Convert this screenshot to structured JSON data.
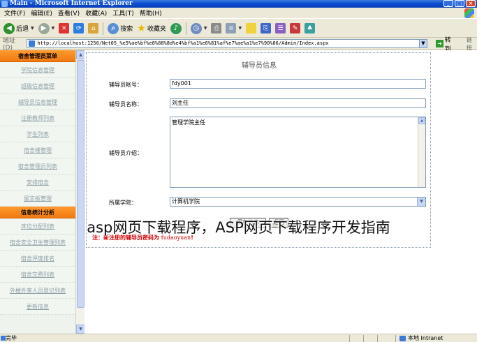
{
  "window": {
    "title": "Main - Microsoft Internet Explorer"
  },
  "menubar": {
    "items": [
      "文件(F)",
      "编辑(E)",
      "查看(V)",
      "收藏(A)",
      "工具(T)",
      "帮助(H)"
    ]
  },
  "toolbar": {
    "back_label": "后退",
    "search_label": "搜索",
    "favorites_label": "收藏夹"
  },
  "addressbar": {
    "label": "地址(D)",
    "url": "http://localhost:1250/Net05_%e5%ae%bf%e8%88%8d%e4%bf%a1%e6%81%af%e7%ae%a1%e7%90%86/Admin/Index.aspx",
    "go_label": "转到",
    "links_label": "链接"
  },
  "sidebar": {
    "section1_title": "宿舍管理员菜单",
    "section1_items": [
      "学院信息管理",
      "班级信息管理",
      "辅导员信息管理",
      "注册教师列表",
      "学生列表",
      "宿舍楼管理",
      "宿舍管理员列表",
      "安排宿舍",
      "留言板管理"
    ],
    "section2_title": "信息统计分析",
    "section2_items": [
      "床位分配列表",
      "宿舍安全卫生管理列表",
      "宿舍评度排名",
      "宿舍交费列表",
      "外楼外来人员登记列表",
      "更新信息"
    ]
  },
  "form": {
    "title": "辅导员信息",
    "account_label": "辅导员帐号：",
    "account_value": "fdy001",
    "name_label": "辅导员名称：",
    "name_value": "刘主任",
    "intro_label": "辅导员介绍：",
    "intro_value": "管理学院主任",
    "college_label": "所属学院：",
    "college_value": "计算机学院",
    "save_label": "保存信息",
    "back_label": "返回",
    "note_prefix": "注：新注册的辅导员密码为",
    "note_password": "fudaoyuan",
    "note_suffix": "!"
  },
  "watermark": {
    "text": "asp网页下载程序，ASP网页下载程序开发指南"
  },
  "statusbar": {
    "left_text": "完毕",
    "right_text": "本地 Intranet"
  },
  "colors": {
    "titlebar": "#0a4bd1",
    "sidebar_header": "#f07a10",
    "note": "#cc0000"
  }
}
